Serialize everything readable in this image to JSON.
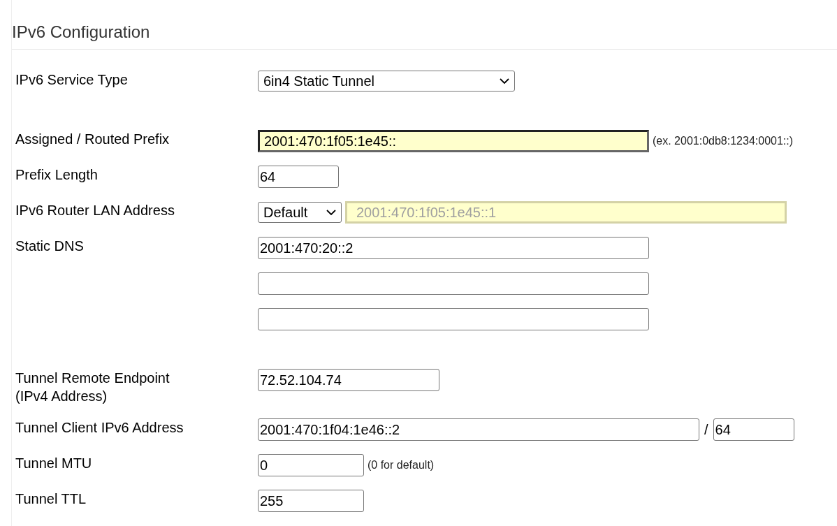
{
  "title": "IPv6 Configuration",
  "sections": [
    [
      {
        "label": "IPv6 Service Type",
        "controls": [
          {
            "kind": "select",
            "value": "6in4 Static Tunnel"
          }
        ]
      }
    ],
    [
      {
        "label": "Assigned / Routed Prefix",
        "controls": [
          {
            "kind": "input",
            "value": "2001:470:1f05:1e45::",
            "focused": true
          },
          {
            "kind": "note",
            "text": "(ex. 2001:0db8:1234:0001::)"
          }
        ]
      },
      {
        "label": "Prefix Length",
        "controls": [
          {
            "kind": "input",
            "value": "64"
          }
        ]
      },
      {
        "label": "IPv6 Router LAN Address",
        "controls": [
          {
            "kind": "select",
            "value": "Default"
          },
          {
            "kind": "input",
            "value": "2001:470:1f05:1e45::1",
            "disabled": true
          }
        ]
      },
      {
        "label": "Static DNS",
        "controls": [
          {
            "kind": "input",
            "value": "2001:470:20::2"
          }
        ]
      },
      {
        "controls": [
          {
            "kind": "input"
          }
        ]
      },
      {
        "controls": [
          {
            "kind": "input"
          }
        ]
      }
    ],
    [
      {
        "label": "Tunnel Remote Endpoint\n(IPv4 Address)",
        "controls": [
          {
            "kind": "input",
            "value": "72.52.104.74"
          }
        ]
      },
      {
        "label": "Tunnel Client IPv6 Address",
        "controls": [
          {
            "kind": "input",
            "value": "2001:470:1f04:1e46::2"
          },
          {
            "kind": "separator",
            "text": "/"
          },
          {
            "kind": "input",
            "value": "64"
          }
        ]
      },
      {
        "label": "Tunnel MTU",
        "controls": [
          {
            "kind": "input",
            "value": "0"
          },
          {
            "kind": "note",
            "text": "(0 for default)"
          }
        ]
      },
      {
        "label": "Tunnel TTL",
        "controls": [
          {
            "kind": "input",
            "value": "255"
          }
        ]
      }
    ]
  ]
}
